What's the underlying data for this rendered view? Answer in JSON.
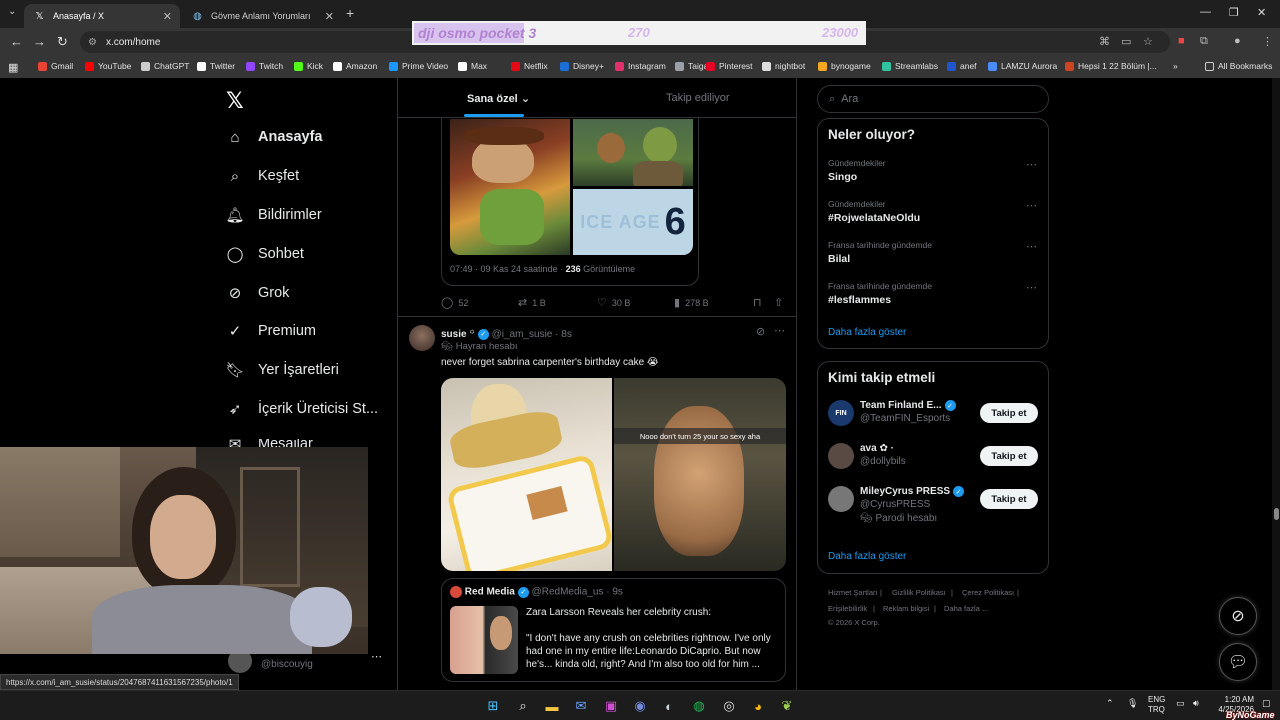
{
  "browser": {
    "tabs": [
      {
        "title": "Anasayfa / X",
        "icon": "x-icon",
        "active": true
      },
      {
        "title": "Gövme Anlamı Yorumları",
        "icon": "globe-icon",
        "active": false
      }
    ],
    "url": "x.com/home",
    "status_url": "https://x.com/i_am_susie/status/2047687411631567235/photo/1",
    "bookmarks": [
      {
        "label": "Gmail",
        "color": "#ea4335"
      },
      {
        "label": "YouTube",
        "color": "#ff0000"
      },
      {
        "label": "ChatGPT",
        "color": "#cccccc"
      },
      {
        "label": "Twitter",
        "color": "#ffffff"
      },
      {
        "label": "Twitch",
        "color": "#9146ff"
      },
      {
        "label": "Kick",
        "color": "#53fc18"
      },
      {
        "label": "Amazon",
        "color": "#ffffff"
      },
      {
        "label": "Prime Video",
        "color": "#1a98ff"
      },
      {
        "label": "Max",
        "color": "#ffffff"
      },
      {
        "label": "Netflix",
        "color": "#e50914"
      },
      {
        "label": "Disney+",
        "color": "#1b6fd6"
      },
      {
        "label": "Instagram",
        "color": "#e1306c"
      },
      {
        "label": "Taiga",
        "color": "#9aa0a6"
      },
      {
        "label": "Pinterest",
        "color": "#e60023"
      },
      {
        "label": "nightbot",
        "color": "#dddddd"
      },
      {
        "label": "bynogame",
        "color": "#f5a623"
      },
      {
        "label": "Streamlabs",
        "color": "#31c3a2"
      },
      {
        "label": "anef",
        "color": "#2255cc"
      },
      {
        "label": "LAMZU Aurora",
        "color": "#4a8cff"
      },
      {
        "label": "Hepsi 1 22 Bölüm |...",
        "color": "#cc4422"
      }
    ],
    "all_bookmarks": "All Bookmarks"
  },
  "stream_overlay": {
    "product": "dji osmo pocket 3",
    "current": "270",
    "goal": "23000"
  },
  "nav": {
    "items": [
      {
        "label": "Anasayfa",
        "icon": "home-icon",
        "glyph": "⌂",
        "active": true
      },
      {
        "label": "Keşfet",
        "icon": "search-icon",
        "glyph": "⌕"
      },
      {
        "label": "Bildirimler",
        "icon": "bell-icon",
        "glyph": "🔔︎"
      },
      {
        "label": "Sohbet",
        "icon": "chat-icon",
        "glyph": "◯"
      },
      {
        "label": "Grok",
        "icon": "grok-icon",
        "glyph": "⊘"
      },
      {
        "label": "Premium",
        "icon": "verified-icon",
        "glyph": "✓"
      },
      {
        "label": "Yer İşaretleri",
        "icon": "bookmark-icon",
        "glyph": "🔖︎"
      },
      {
        "label": "İçerik Üreticisi St...",
        "icon": "rocket-icon",
        "glyph": "➶"
      },
      {
        "label": "Mesajlar",
        "icon": "mail-icon",
        "glyph": "✉"
      }
    ],
    "account_handle": "@biscouyig"
  },
  "timeline": {
    "tabs": {
      "for_you": "Sana özel",
      "following": "Takip ediliyor"
    },
    "quoted_post": {
      "meta_time": "07:49 · 09 Kas 24 saatinde · ",
      "views_count": "236",
      "views_label": "Görüntüleme",
      "ice_age_text": "ICE AGE",
      "ice_age_num": "6"
    },
    "prev_actions": {
      "replies": "52",
      "reposts": "1 B",
      "likes": "30 B",
      "views": "278 B"
    },
    "post": {
      "name": "susie",
      "name_suffix": "꙳",
      "handle": "@i_am_susie",
      "time": "8s",
      "label": "Hayran hesabı",
      "text": "never forget sabrina carpenter's birthday cake 😭",
      "image_caption": "Nooo don't turn 25 your so sexy aha"
    },
    "quote": {
      "name": "Red Media",
      "handle": "@RedMedia_us",
      "time": "9s",
      "headline": "Zara Larsson Reveals her celebrity crush:",
      "body": "\"I don't have any crush on celebrities rightnow. I've only had one in my entire life:Leonardo DiCaprio. But now he's... kinda old, right? And I'm also too old for him ..."
    }
  },
  "sidebar": {
    "search_placeholder": "Ara",
    "trends_title": "Neler oluyor?",
    "trends": [
      {
        "context": "Gündemdekiler",
        "name": "Singo"
      },
      {
        "context": "Gündemdekiler",
        "name": "#RojwelataNeOldu"
      },
      {
        "context": "Fransa tarihinde gündemde",
        "name": "Bilal"
      },
      {
        "context": "Fransa tarihinde gündemde",
        "name": "#lesflammes"
      }
    ],
    "show_more": "Daha fazla göster",
    "follow_title": "Kimi takip etmeli",
    "follow": [
      {
        "name": "Team Finland E...",
        "handle": "@TeamFIN_Esports",
        "extra": "",
        "avatar_text": "FIN",
        "avatar_color": "#1a3a6e"
      },
      {
        "name": "ava ✿ ·",
        "handle": "@dollybils",
        "extra": "",
        "avatar_text": "",
        "avatar_color": "#5a4a44"
      },
      {
        "name": "MileyCyrus PRESS",
        "handle": "@CyrusPRESS",
        "extra": "Parodi hesabı",
        "avatar_text": "",
        "avatar_color": "#777777"
      }
    ],
    "follow_button": "Takip et",
    "footer": [
      "Hizmet Şartları",
      "Gizlilik Politikası",
      "Çerez Politikası",
      "Erişilebilirlik",
      "Reklam bilgisi",
      "Daha fazla ...",
      "© 2026 X Corp."
    ]
  },
  "taskbar": {
    "lang": "ENG",
    "lang_sub": "TRQ",
    "time": "1:20 AM",
    "date": "4/25/2026",
    "watermark": "ByNoGame"
  },
  "colors": {
    "accent": "#1d9bf0",
    "bg": "#000000",
    "border": "#2f3336",
    "muted": "#71767b"
  }
}
